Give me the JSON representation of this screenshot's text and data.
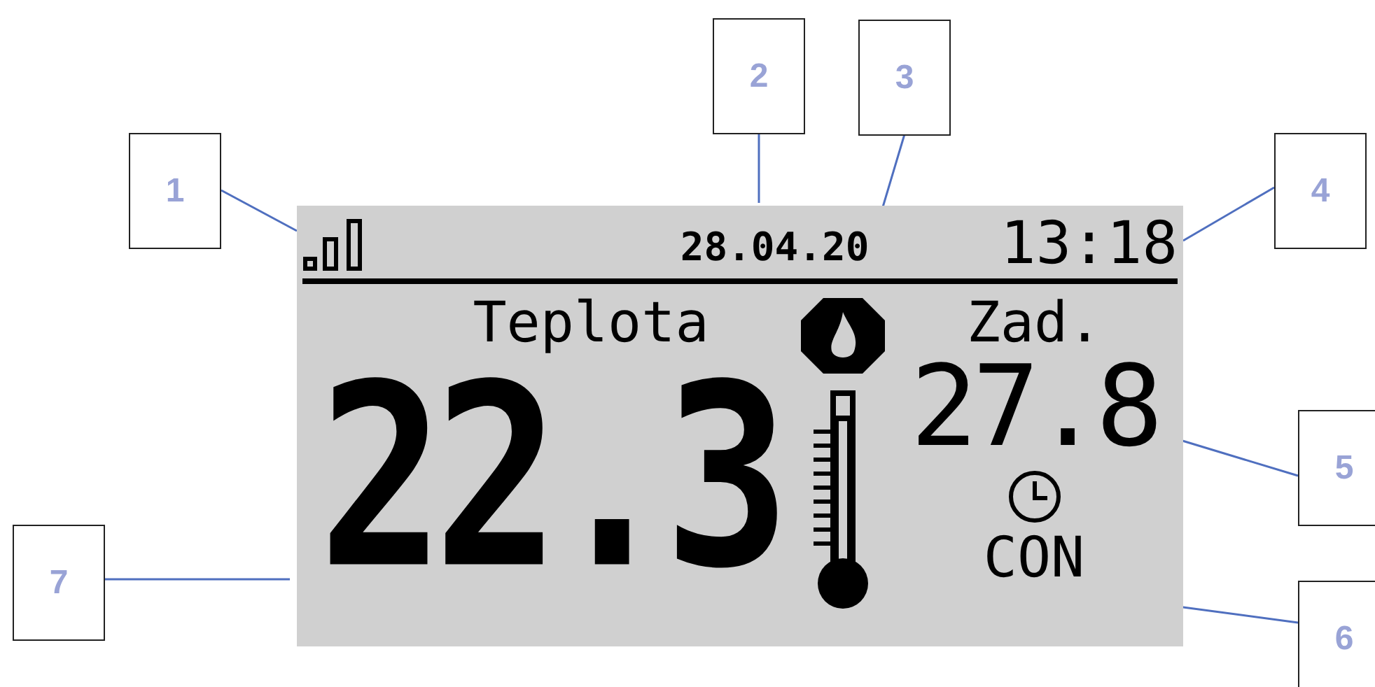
{
  "display": {
    "date": "28.04.20",
    "time": "13:18",
    "current_label": "Teplota",
    "current_temperature": "22.3",
    "setpoint_label": "Zad.",
    "setpoint_temperature": "27.8",
    "mode": "CON"
  },
  "callouts": [
    {
      "label": "1"
    },
    {
      "label": "2"
    },
    {
      "label": "3"
    },
    {
      "label": "4"
    },
    {
      "label": "5"
    },
    {
      "label": "6"
    },
    {
      "label": "7"
    }
  ]
}
